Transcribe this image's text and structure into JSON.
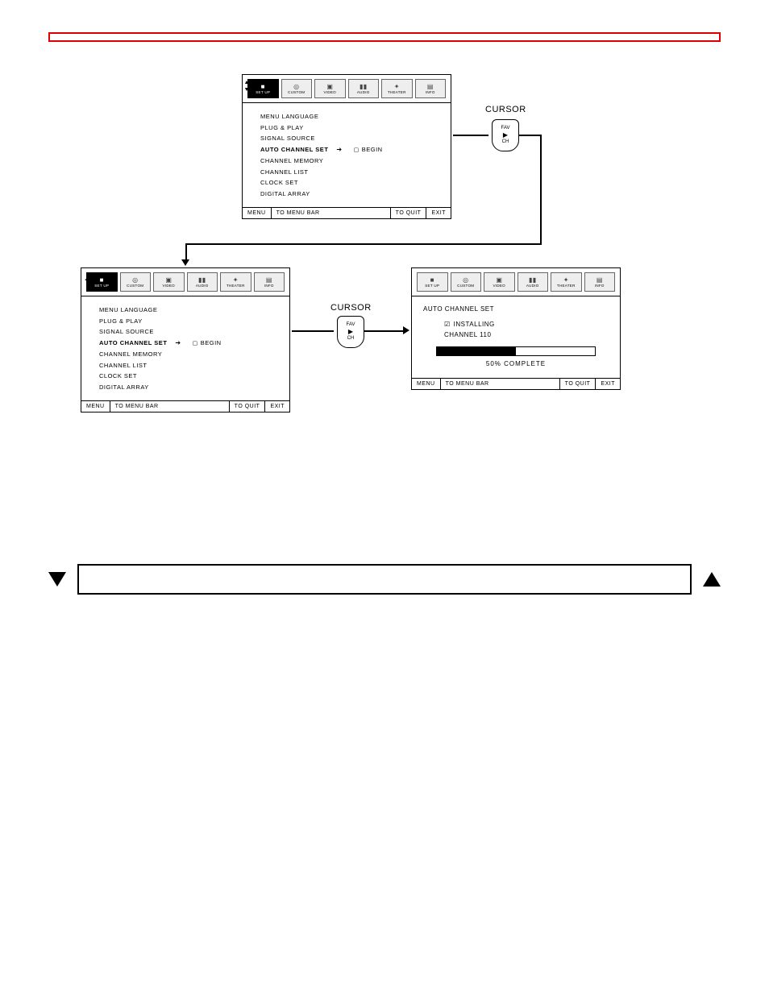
{
  "tabs": [
    "SET UP",
    "CUSTOM",
    "VIDEO",
    "AUDIO",
    "THEATER",
    "INFO"
  ],
  "tab_icons": [
    "■",
    "◎",
    "▣",
    "▮▮",
    "✦",
    "▤"
  ],
  "menu_items": [
    "MENU LANGUAGE",
    "PLUG & PLAY",
    "SIGNAL SOURCE",
    "AUTO CHANNEL SET",
    "CHANNEL MEMORY",
    "CHANNEL LIST",
    "CLOCK SET",
    "DIGITAL ARRAY"
  ],
  "begin_label": "BEGIN",
  "footer": {
    "menu": "MENU",
    "to_bar": "TO MENU BAR",
    "to_quit": "TO QUIT",
    "exit": "EXIT"
  },
  "cursor_label": "CURSOR",
  "cursor_btn": {
    "top": "FAV",
    "mid": "▶",
    "bot": "CH"
  },
  "panel1_arrows": {
    "up": "▲",
    "down": "▼"
  },
  "panel2_arrows": {
    "left": "◀",
    "right": "▶"
  },
  "progress": {
    "title": "AUTO CHANNEL SET",
    "installing": "INSTALLING",
    "channel": "CHANNEL 110",
    "percent": 50,
    "complete_label": "50% COMPLETE"
  }
}
